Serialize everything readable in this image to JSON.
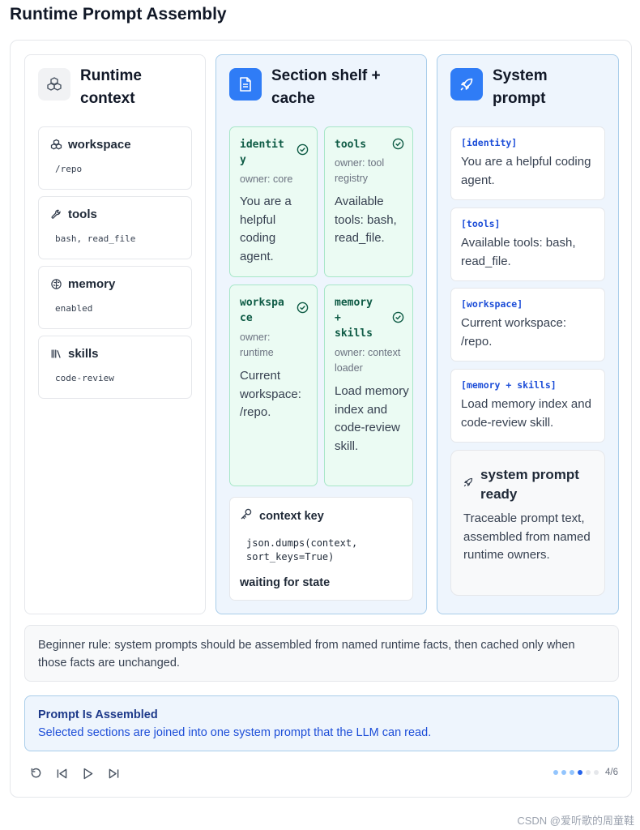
{
  "page": {
    "title": "Runtime Prompt Assembly"
  },
  "colors": {
    "accent": "#2f7cf6",
    "section_green": "#ebfbf3",
    "panel_blue": "#eef5fd",
    "check_green": "#0e5b45"
  },
  "runtime_context": {
    "title": "Runtime context",
    "icon": "cubes-icon",
    "items": [
      {
        "label": "workspace",
        "value": "/repo",
        "icon": "cubes-icon"
      },
      {
        "label": "tools",
        "value": "bash, read_file",
        "icon": "wrench-icon"
      },
      {
        "label": "memory",
        "value": "enabled",
        "icon": "brain-icon"
      },
      {
        "label": "skills",
        "value": "code-review",
        "icon": "library-icon"
      }
    ]
  },
  "section_shelf": {
    "title": "Section shelf + cache",
    "icon": "document-icon",
    "sections": [
      {
        "name": "identity",
        "owner": "owner: core",
        "body": "You are a helpful coding agent.",
        "status_icon": "check-circle-icon"
      },
      {
        "name": "tools",
        "owner": "owner: tool registry",
        "body": "Available tools: bash, read_file.",
        "status_icon": "check-circle-icon"
      },
      {
        "name": "workspace",
        "owner": "owner: runtime",
        "body": "Current workspace: /repo.",
        "status_icon": "check-circle-icon"
      },
      {
        "name": "memory + skills",
        "owner": "owner: context loader",
        "body": "Load memory index and code-review skill.",
        "status_icon": "check-circle-icon"
      }
    ],
    "context_key": {
      "label": "context key",
      "icon": "key-icon",
      "code": "json.dumps(context,\nsort_keys=True)",
      "state": "waiting for state"
    }
  },
  "system_prompt": {
    "title": "System prompt",
    "icon": "rocket-icon",
    "parts": [
      {
        "tag": "[identity]",
        "text": "You are a helpful coding agent."
      },
      {
        "tag": "[tools]",
        "text": "Available tools: bash, read_file."
      },
      {
        "tag": "[workspace]",
        "text": "Current workspace: /repo."
      },
      {
        "tag": "[memory + skills]",
        "text": "Load memory index and code-review skill."
      }
    ],
    "ready": {
      "label": "system prompt ready",
      "text": "Traceable prompt text, assembled from named runtime owners."
    }
  },
  "rule": "Beginner rule: system prompts should be assembled from named runtime facts, then cached only when those facts are unchanged.",
  "status": {
    "title": "Prompt Is Assembled",
    "description": "Selected sections are joined into one system prompt that the LLM can read."
  },
  "pager": {
    "current": 4,
    "total": 6,
    "label": "4/6"
  },
  "watermark": "CSDN @爱听歌的周童鞋"
}
